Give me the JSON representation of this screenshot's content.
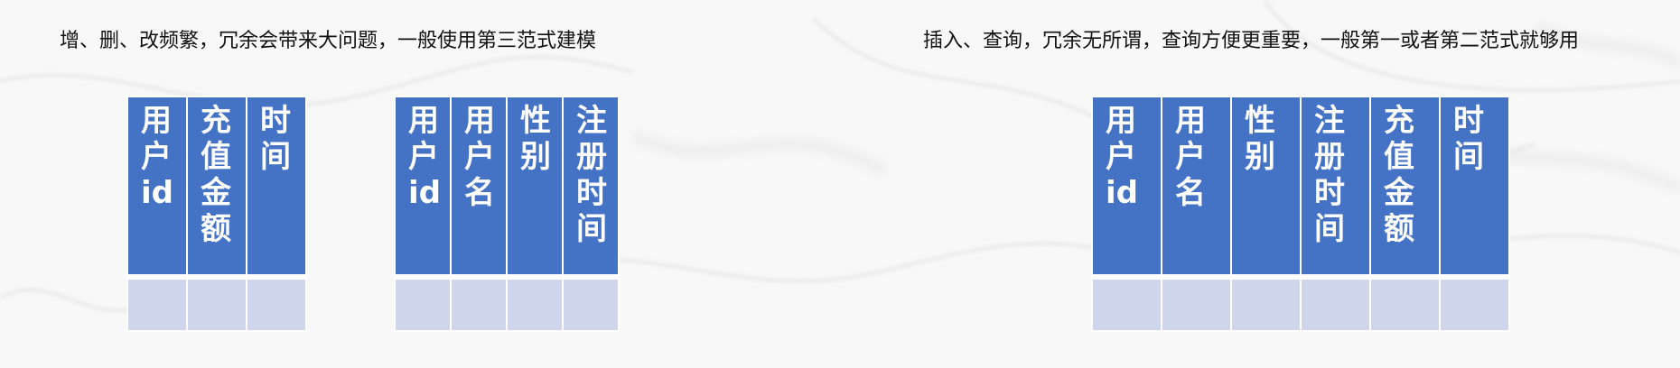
{
  "captions": {
    "left": "增、删、改频繁，冗余会带来大问题，一般使用第三范式建模",
    "right": "插入、查询，冗余无所谓，查询方便更重要，一般第一或者第二范式就够用"
  },
  "tables": [
    {
      "columns": [
        "用户id",
        "充值金额",
        "时间"
      ],
      "rows": [
        [
          "",
          "",
          ""
        ]
      ]
    },
    {
      "columns": [
        "用户id",
        "用户名",
        "性别",
        "注册时间"
      ],
      "rows": [
        [
          "",
          "",
          "",
          ""
        ]
      ]
    },
    {
      "columns": [
        "用户id",
        "用户名",
        "性别",
        "注册时间",
        "充值金额",
        "时间"
      ],
      "rows": [
        [
          "",
          "",
          "",
          "",
          "",
          ""
        ]
      ]
    }
  ],
  "colors": {
    "header_fill": "#4472c4",
    "row_fill": "#cfd5ea",
    "header_text": "#ffffff"
  }
}
